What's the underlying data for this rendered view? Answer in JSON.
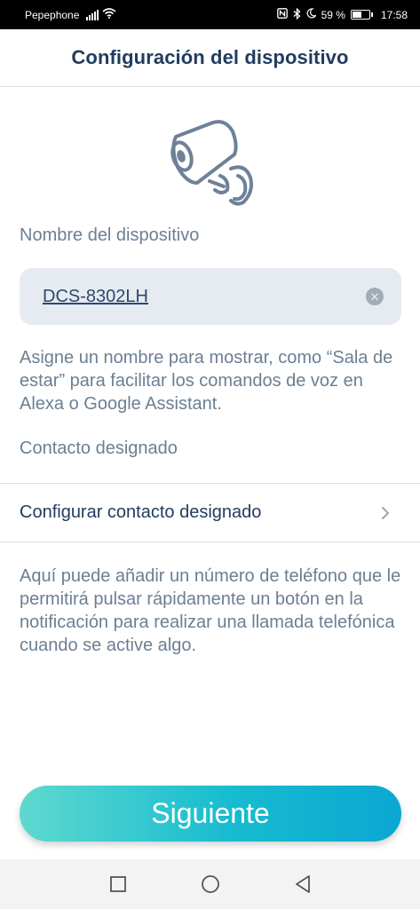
{
  "status_bar": {
    "carrier": "Pepephone",
    "battery": "59 %",
    "battery_level": 0.59,
    "time": "17:58",
    "icons": [
      "signal-icon",
      "wifi-icon",
      "nfc-icon",
      "bluetooth-icon",
      "moon-icon",
      "battery-icon"
    ]
  },
  "header": {
    "title": "Configuración del dispositivo"
  },
  "device": {
    "image_icon": "camera-icon",
    "name_label": "Nombre del dispositivo",
    "name_value": "DCS-8302LH",
    "name_help": "Asigne un nombre para mostrar, como “Sala de estar” para facilitar los comandos de voz en Alexa o Google Assistant."
  },
  "contact": {
    "section_label": "Contacto designado",
    "row_label": "Configurar contacto designado",
    "help": "Aquí puede añadir un número de teléfono que le permitirá pulsar rápidamente un botón en la notificación para realizar una llamada telefónica cuando se active algo."
  },
  "actions": {
    "next_label": "Siguiente"
  },
  "colors": {
    "title": "#213d5f",
    "secondary_text": "#6b7f93",
    "field_bg": "#e6ebf1",
    "button_gradient_start": "#5ed9cf",
    "button_gradient_end": "#0ba7d2"
  }
}
